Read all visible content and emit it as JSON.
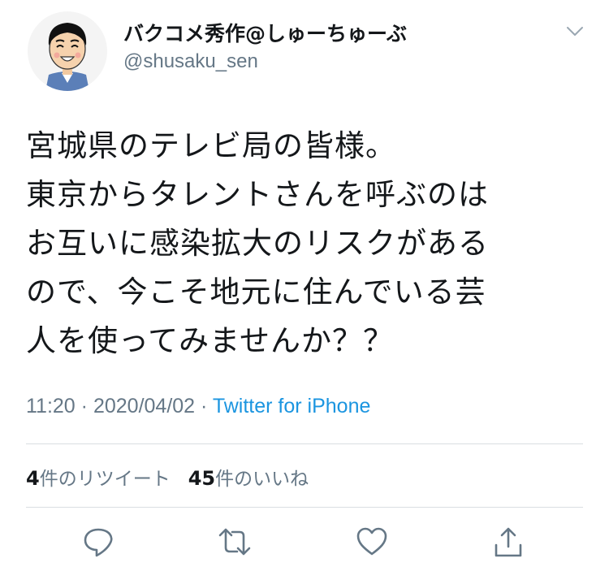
{
  "author": {
    "display_name": "バクコメ秀作@しゅーちゅーぶ",
    "handle": "@shusaku_sen",
    "avatar_icon": "cartoon-avatar-icon"
  },
  "tweet": {
    "lines": [
      "宮城県のテレビ局の皆様。",
      "東京からタレントさんを呼ぶのは",
      "お互いに感染拡大のリスクがある",
      "ので、今こそ地元に住んでいる芸",
      "人を使ってみませんか？？"
    ],
    "time": "11:20",
    "separator": "·",
    "date": "2020/04/02",
    "source": "Twitter for iPhone"
  },
  "stats": {
    "retweet_count": "4",
    "retweet_label": "件のリツイート",
    "like_count": "45",
    "like_label": "件のいいね"
  },
  "actions": [
    "reply-icon",
    "retweet-icon",
    "like-icon",
    "share-icon"
  ],
  "colors": {
    "text": "#14171a",
    "secondary": "#657786",
    "link": "#1b95e0",
    "divider": "#d9dee2"
  }
}
